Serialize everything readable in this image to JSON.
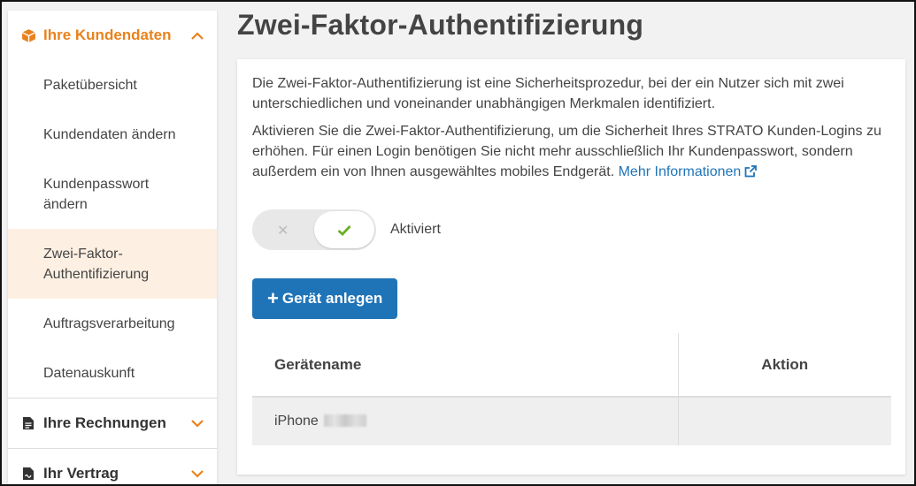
{
  "sidebar": {
    "section_customer": {
      "label": "Ihre Kundendaten",
      "icon": "box-icon",
      "expanded": true
    },
    "items": [
      {
        "label": "Paketübersicht"
      },
      {
        "label": "Kundendaten ändern"
      },
      {
        "label": "Kundenpasswort ändern"
      },
      {
        "label": "Zwei-Faktor-Authentifizierung",
        "selected": true
      },
      {
        "label": "Auftragsverarbeitung"
      },
      {
        "label": "Datenauskunft"
      }
    ],
    "section_invoices": {
      "label": "Ihre Rechnungen",
      "icon": "document-icon"
    },
    "section_contract": {
      "label": "Ihr Vertrag",
      "icon": "contract-icon"
    }
  },
  "main": {
    "title": "Zwei-Faktor-Authentifizierung",
    "intro": "Die Zwei-Faktor-Authentifizierung ist eine Sicherheitsprozedur, bei der ein Nutzer sich mit zwei unterschiedlichen und voneinander unabhängigen Merkmalen identifiziert.",
    "description": "Aktivieren Sie die Zwei-Faktor-Authentifizierung, um die Sicherheit Ihres STRATO Kunden-Logins zu erhöhen. Für einen Login benötigen Sie nicht mehr ausschließlich Ihr Kundenpasswort, sondern außerdem ein von Ihnen ausgewähltes mobiles Endgerät.",
    "more_info_link": "Mehr Informationen",
    "toggle": {
      "state": "on",
      "off_glyph": "✕",
      "on_glyph": "✔",
      "label": "Aktiviert"
    },
    "add_button": {
      "plus": "+",
      "label": "Gerät anlegen"
    },
    "table": {
      "headers": {
        "name": "Gerätename",
        "action": "Aktion"
      },
      "rows": [
        {
          "name": "iPhone",
          "action": ""
        }
      ]
    }
  },
  "colors": {
    "accent": "#e8821c",
    "primary": "#1f74b8",
    "check": "#6ab023"
  }
}
